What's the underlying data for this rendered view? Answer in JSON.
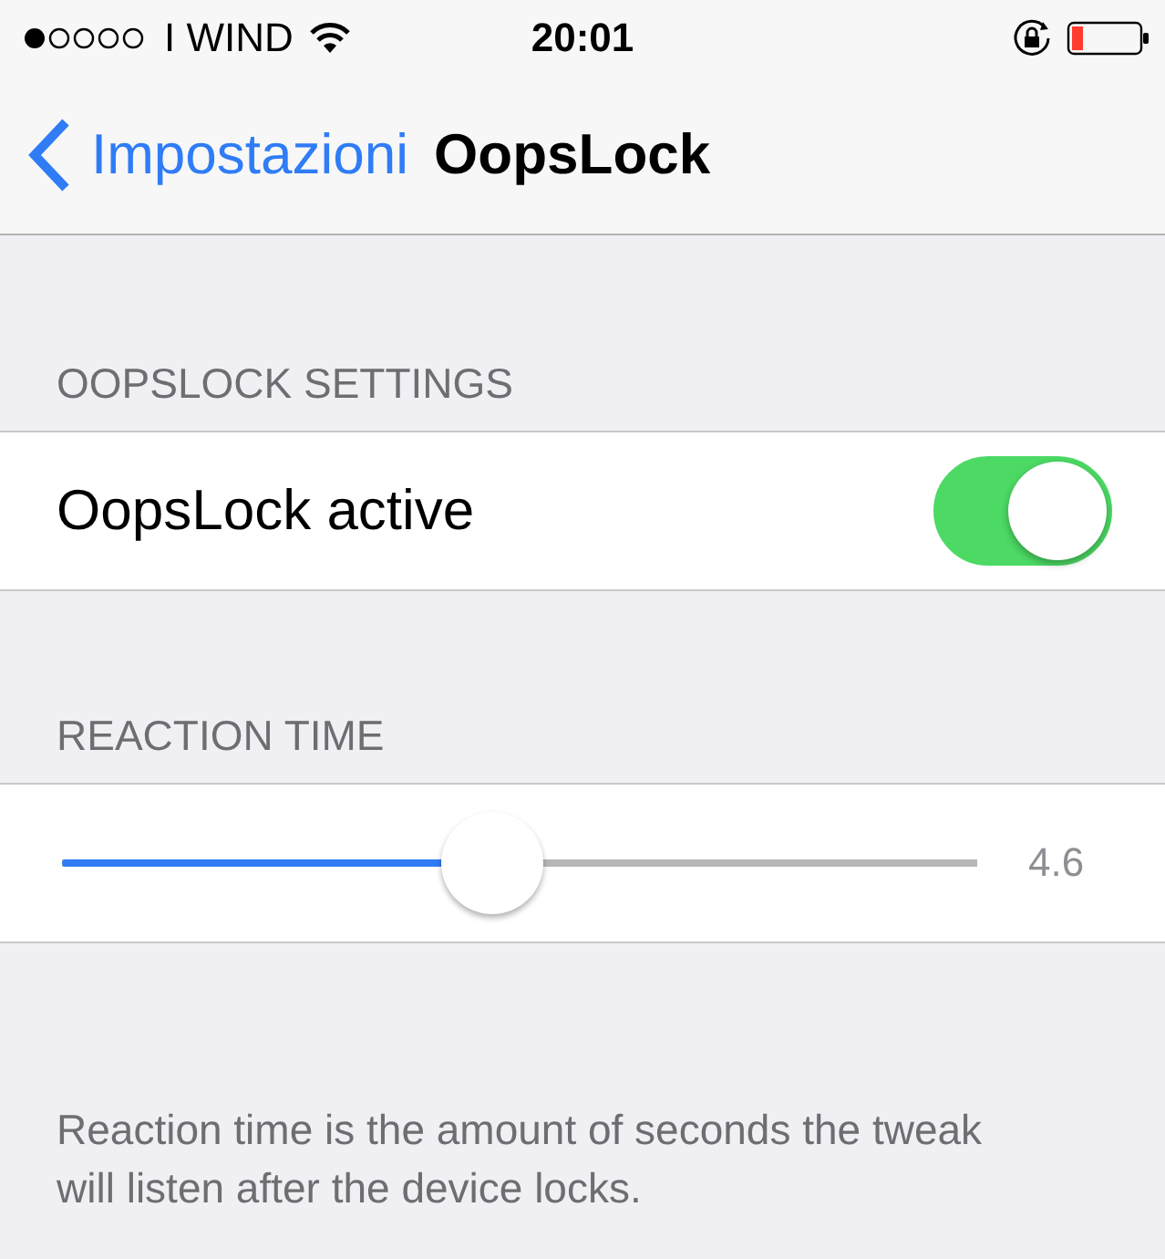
{
  "status_bar": {
    "carrier": "I WIND",
    "time": "20:01"
  },
  "nav": {
    "back": "Impostazioni",
    "title": "OopsLock"
  },
  "sections": [
    {
      "header": "OOPSLOCK SETTINGS",
      "rows": [
        {
          "kind": "switch",
          "label": "OopsLock active",
          "on": true
        }
      ]
    },
    {
      "header": "REACTION TIME",
      "rows": [
        {
          "kind": "slider",
          "level": 0.47,
          "reading": "4.6"
        }
      ],
      "footer": "Reaction time is the amount of seconds the tweak will listen after the device locks."
    }
  ]
}
